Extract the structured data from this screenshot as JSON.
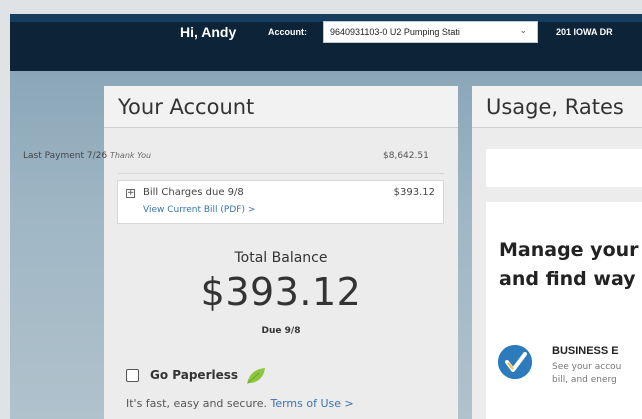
{
  "header": {
    "greeting": "Hi, Andy",
    "account_label": "Account:",
    "account_value": "9640931103-0 U2 Pumping Stati",
    "address": "201 IOWA DR"
  },
  "your_account": {
    "title": "Your Account",
    "last_payment_label": "Last Payment 7/26",
    "last_payment_note": "Thank You",
    "last_payment_amount": "$8,642.51",
    "bill_charges_label": "Bill Charges due 9/8",
    "bill_charges_amount": "$393.12",
    "view_bill_link": "View Current Bill (PDF) >",
    "total_balance_label": "Total Balance",
    "total_balance_amount": "$393.12",
    "due_text": "Due 9/8",
    "go_paperless_label": "Go Paperless",
    "paperless_text": "It's fast, easy and secure.",
    "terms_link": "Terms of Use >"
  },
  "usage": {
    "title": "Usage, Rates",
    "manage_line1": "Manage your",
    "manage_line2": "and find way",
    "business_title": "BUSINESS E",
    "business_desc_line1": "See your accou",
    "business_desc_line2": "bill, and energ"
  },
  "colors": {
    "header_bg": "#0c2338",
    "link": "#3a73b0",
    "brand_blue": "#2b7bbd"
  },
  "icons": {
    "dropdown": "chevron-down-icon",
    "expand": "plus-box-icon",
    "leaf": "leaf-icon",
    "business": "checkmark-badge-icon"
  }
}
